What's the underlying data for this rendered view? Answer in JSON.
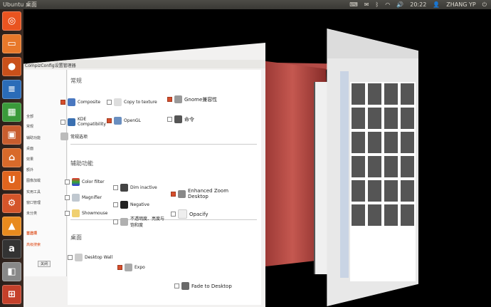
{
  "topbar": {
    "title": "Ubuntu 桌面",
    "clock": "20:22",
    "user": "ZHANG YP"
  },
  "colors": {
    "accent": "#dd4814",
    "panel": "#3c3b37"
  },
  "launcher": {
    "icons": [
      "ubuntu-home-icon",
      "files-icon",
      "firefox-icon",
      "writer-icon",
      "calc-icon",
      "impress-icon",
      "software-center-icon",
      "ubuntuone-icon",
      "settings-icon",
      "vlc-icon",
      "amazon-icon",
      "disk-icon",
      "workspace-icon"
    ]
  },
  "ccsm": {
    "window_title": "CompizConfig设置管理器",
    "categories": {
      "general": "常规",
      "accessibility": "辅助功能",
      "desktop": "桌面"
    },
    "sidebar": [
      "全部",
      "常规",
      "辅助功能",
      "桌面",
      "效果",
      "额外",
      "图像加载",
      "实用工具",
      "窗口管理",
      "未分类"
    ],
    "sidebar_selected": "首选项",
    "sidebar_extra": "高级搜索",
    "close_label": "关闭",
    "general_items": [
      {
        "label": "Composite",
        "checked": true
      },
      {
        "label": "Copy to texture",
        "checked": false
      },
      {
        "label": "Gnome兼容性",
        "checked": true
      },
      {
        "label": "KDE Compatibility",
        "checked": false
      },
      {
        "label": "OpenGL",
        "checked": true
      },
      {
        "label": "命令",
        "checked": false
      },
      {
        "label": "常规选项",
        "checked": false
      }
    ],
    "access_items": [
      {
        "label": "Color filter",
        "checked": false
      },
      {
        "label": "Dim inactive",
        "checked": false
      },
      {
        "label": "Enhanced Zoom Desktop",
        "checked": true
      },
      {
        "label": "Magnifier",
        "checked": false
      },
      {
        "label": "Negative",
        "checked": false
      },
      {
        "label": "Opacify",
        "checked": false
      },
      {
        "label": "Showmouse",
        "checked": false
      },
      {
        "label": "不透明度、亮度与饱和度",
        "checked": false
      }
    ],
    "desktop_items": [
      {
        "label": "Desktop Wall",
        "checked": false
      },
      {
        "label": "Expo",
        "checked": true
      },
      {
        "label": "Fade to Desktop",
        "checked": false
      }
    ]
  }
}
